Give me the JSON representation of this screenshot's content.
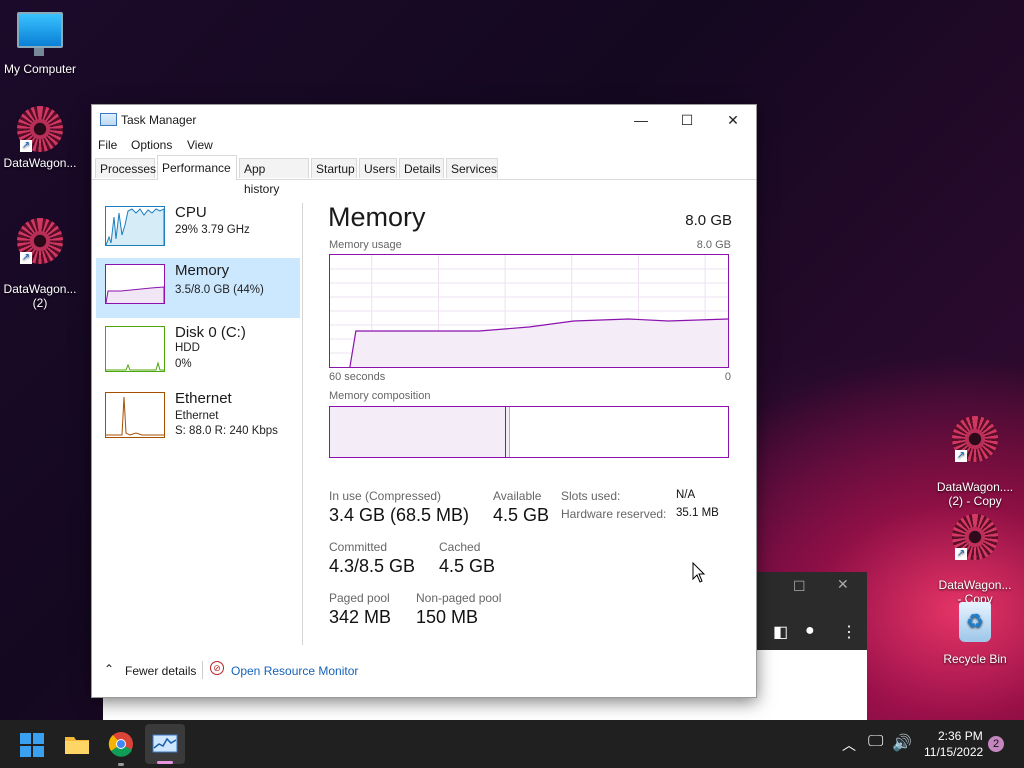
{
  "desktop": {
    "icons": [
      {
        "label": "My Computer"
      },
      {
        "label": "DataWagon..."
      },
      {
        "label": "DataWagon...\n(2)"
      },
      {
        "label": "DataWagon....\n(2) - Copy"
      },
      {
        "label": "DataWagon...\n- Copy"
      },
      {
        "label": "Recycle Bin"
      }
    ]
  },
  "window": {
    "title": "Task Manager",
    "menu": [
      "File",
      "Options",
      "View"
    ],
    "tabs": [
      "Processes",
      "Performance",
      "App history",
      "Startup",
      "Users",
      "Details",
      "Services"
    ],
    "active_tab": "Performance",
    "resources": [
      {
        "name": "CPU",
        "sub1": "29% 3.79 GHz",
        "sub2": "",
        "color": "#1b7fbf"
      },
      {
        "name": "Memory",
        "sub1": "3.5/8.0 GB (44%)",
        "sub2": "",
        "color": "#8b12ae"
      },
      {
        "name": "Disk 0 (C:)",
        "sub1": "HDD",
        "sub2": "0%",
        "color": "#4da60c"
      },
      {
        "name": "Ethernet",
        "sub1": "Ethernet",
        "sub2": "S: 88.0  R: 240 Kbps",
        "color": "#a74f01"
      }
    ],
    "memory": {
      "title": "Memory",
      "total": "8.0 GB",
      "usage_label": "Memory usage",
      "usage_max": "8.0 GB",
      "time_left": "60 seconds",
      "time_right": "0",
      "composition_label": "Memory composition",
      "in_use_fraction": 0.44,
      "stats": {
        "in_use_label": "In use (Compressed)",
        "in_use_value": "3.4 GB (68.5 MB)",
        "available_label": "Available",
        "available_value": "4.5 GB",
        "slots_label": "Slots used:",
        "slots_value": "N/A",
        "hw_label": "Hardware reserved:",
        "hw_value": "35.1 MB",
        "committed_label": "Committed",
        "committed_value": "4.3/8.5 GB",
        "cached_label": "Cached",
        "cached_value": "4.5 GB",
        "paged_label": "Paged pool",
        "paged_value": "342 MB",
        "nonpaged_label": "Non-paged pool",
        "nonpaged_value": "150 MB"
      }
    },
    "footer": {
      "fewer_details": "Fewer details",
      "resource_monitor": "Open Resource Monitor"
    }
  },
  "taskbar": {
    "time": "2:36 PM",
    "date": "11/15/2022",
    "notification_count": "2"
  }
}
